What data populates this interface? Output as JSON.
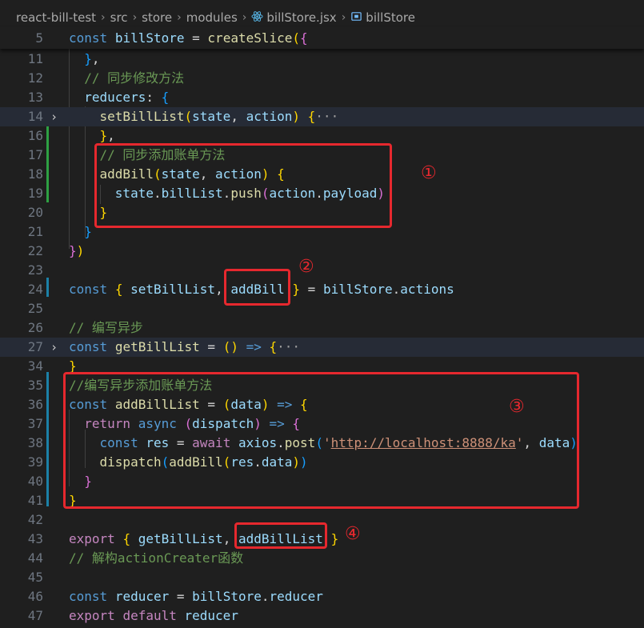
{
  "breadcrumb": {
    "items": [
      "react-bill-test",
      "src",
      "store",
      "modules",
      "billStore.jsx",
      "billStore"
    ],
    "separator": "›"
  },
  "sticky": {
    "line_number": "5",
    "tokens": [
      [
        "const",
        "k"
      ],
      [
        " ",
        "p"
      ],
      [
        "billStore",
        "v"
      ],
      [
        " = ",
        "p"
      ],
      [
        "createSlice",
        "f"
      ],
      [
        "(",
        "b1"
      ],
      [
        "{",
        "b2"
      ]
    ]
  },
  "code_lines": [
    {
      "n": "11",
      "tokens": [
        [
          "  ",
          "p"
        ],
        [
          "}",
          "b3"
        ],
        [
          ",",
          "p"
        ]
      ]
    },
    {
      "n": "12",
      "tokens": [
        [
          "  ",
          "p"
        ],
        [
          "// 同步修改方法",
          "cm"
        ]
      ]
    },
    {
      "n": "13",
      "tokens": [
        [
          "  ",
          "p"
        ],
        [
          "reducers",
          "v"
        ],
        [
          ": ",
          "p"
        ],
        [
          "{",
          "b3"
        ]
      ]
    },
    {
      "n": "14",
      "fold": "›",
      "highlight": true,
      "tokens": [
        [
          "    ",
          "p"
        ],
        [
          "setBillList",
          "f"
        ],
        [
          "(",
          "b1"
        ],
        [
          "state",
          "v"
        ],
        [
          ", ",
          "p"
        ],
        [
          "action",
          "v"
        ],
        [
          ")",
          "b1"
        ],
        [
          " ",
          "p"
        ],
        [
          "{",
          "b1"
        ],
        [
          "···",
          "dots"
        ]
      ]
    },
    {
      "n": "16",
      "tokens": [
        [
          "    ",
          "p"
        ],
        [
          "}",
          "b1"
        ],
        [
          ",",
          "p"
        ]
      ]
    },
    {
      "n": "17",
      "tokens": [
        [
          "    ",
          "p"
        ],
        [
          "// 同步添加账单方法",
          "cm"
        ]
      ]
    },
    {
      "n": "18",
      "tokens": [
        [
          "    ",
          "p"
        ],
        [
          "addBill",
          "f"
        ],
        [
          "(",
          "b1"
        ],
        [
          "state",
          "v"
        ],
        [
          ", ",
          "p"
        ],
        [
          "action",
          "v"
        ],
        [
          ")",
          "b1"
        ],
        [
          " ",
          "p"
        ],
        [
          "{",
          "b1"
        ]
      ]
    },
    {
      "n": "19",
      "tokens": [
        [
          "      ",
          "p"
        ],
        [
          "state",
          "v"
        ],
        [
          ".",
          "p"
        ],
        [
          "billList",
          "v"
        ],
        [
          ".",
          "p"
        ],
        [
          "push",
          "f"
        ],
        [
          "(",
          "b2"
        ],
        [
          "action",
          "v"
        ],
        [
          ".",
          "p"
        ],
        [
          "payload",
          "v"
        ],
        [
          ")",
          "b2"
        ]
      ]
    },
    {
      "n": "20",
      "tokens": [
        [
          "    ",
          "p"
        ],
        [
          "}",
          "b1"
        ]
      ]
    },
    {
      "n": "21",
      "tokens": [
        [
          "  ",
          "p"
        ],
        [
          "}",
          "b3"
        ]
      ]
    },
    {
      "n": "22",
      "tokens": [
        [
          "}",
          "b2"
        ],
        [
          ")",
          "b1"
        ]
      ]
    },
    {
      "n": "23",
      "tokens": []
    },
    {
      "n": "24",
      "tokens": [
        [
          "const",
          "k"
        ],
        [
          " ",
          "p"
        ],
        [
          "{",
          "b1"
        ],
        [
          " ",
          "p"
        ],
        [
          "setBillList",
          "v"
        ],
        [
          ", ",
          "p"
        ],
        [
          "addBill",
          "v"
        ],
        [
          " ",
          "p"
        ],
        [
          "}",
          "b1"
        ],
        [
          " = ",
          "p"
        ],
        [
          "billStore",
          "v"
        ],
        [
          ".",
          "p"
        ],
        [
          "actions",
          "v"
        ]
      ]
    },
    {
      "n": "25",
      "tokens": []
    },
    {
      "n": "26",
      "tokens": [
        [
          "// 编写异步",
          "cm"
        ]
      ]
    },
    {
      "n": "27",
      "fold": "›",
      "highlight": true,
      "tokens": [
        [
          "const",
          "k"
        ],
        [
          " ",
          "p"
        ],
        [
          "getBillList",
          "f"
        ],
        [
          " = ",
          "p"
        ],
        [
          "()",
          "b1"
        ],
        [
          " ",
          "p"
        ],
        [
          "=>",
          "k"
        ],
        [
          " ",
          "p"
        ],
        [
          "{",
          "b1"
        ],
        [
          "···",
          "dots"
        ]
      ]
    },
    {
      "n": "34",
      "tokens": [
        [
          "}",
          "b1"
        ]
      ]
    },
    {
      "n": "35",
      "tokens": [
        [
          "//编写异步添加账单方法",
          "cm"
        ]
      ]
    },
    {
      "n": "36",
      "tokens": [
        [
          "const",
          "k"
        ],
        [
          " ",
          "p"
        ],
        [
          "addBillList",
          "f"
        ],
        [
          " = ",
          "p"
        ],
        [
          "(",
          "b1"
        ],
        [
          "data",
          "v"
        ],
        [
          ")",
          "b1"
        ],
        [
          " ",
          "p"
        ],
        [
          "=>",
          "k"
        ],
        [
          " ",
          "p"
        ],
        [
          "{",
          "b1"
        ]
      ]
    },
    {
      "n": "37",
      "tokens": [
        [
          "  ",
          "p"
        ],
        [
          "return",
          "c"
        ],
        [
          " ",
          "p"
        ],
        [
          "async",
          "k"
        ],
        [
          " ",
          "p"
        ],
        [
          "(",
          "b2"
        ],
        [
          "dispatch",
          "v"
        ],
        [
          ")",
          "b2"
        ],
        [
          " ",
          "p"
        ],
        [
          "=>",
          "k"
        ],
        [
          " ",
          "p"
        ],
        [
          "{",
          "b2"
        ]
      ]
    },
    {
      "n": "38",
      "tokens": [
        [
          "    ",
          "p"
        ],
        [
          "const",
          "k"
        ],
        [
          " ",
          "p"
        ],
        [
          "res",
          "v"
        ],
        [
          " = ",
          "p"
        ],
        [
          "await",
          "c"
        ],
        [
          " ",
          "p"
        ],
        [
          "axios",
          "v"
        ],
        [
          ".",
          "p"
        ],
        [
          "post",
          "f"
        ],
        [
          "(",
          "b3"
        ],
        [
          "'",
          "s"
        ],
        [
          "http://localhost:8888/ka",
          "s url"
        ],
        [
          "'",
          "s"
        ],
        [
          ", ",
          "p"
        ],
        [
          "data",
          "v"
        ],
        [
          ")",
          "b3"
        ]
      ]
    },
    {
      "n": "39",
      "tokens": [
        [
          "    ",
          "p"
        ],
        [
          "dispatch",
          "f"
        ],
        [
          "(",
          "b3"
        ],
        [
          "addBill",
          "f"
        ],
        [
          "(",
          "b1"
        ],
        [
          "res",
          "v"
        ],
        [
          ".",
          "p"
        ],
        [
          "data",
          "v"
        ],
        [
          ")",
          "b1"
        ],
        [
          ")",
          "b3"
        ]
      ]
    },
    {
      "n": "40",
      "tokens": [
        [
          "  ",
          "p"
        ],
        [
          "}",
          "b2"
        ]
      ]
    },
    {
      "n": "41",
      "tokens": [
        [
          "}",
          "b1"
        ]
      ]
    },
    {
      "n": "42",
      "tokens": []
    },
    {
      "n": "43",
      "tokens": [
        [
          "export",
          "c"
        ],
        [
          " ",
          "p"
        ],
        [
          "{",
          "b1"
        ],
        [
          " ",
          "p"
        ],
        [
          "getBillList",
          "v"
        ],
        [
          ", ",
          "p"
        ],
        [
          "addBillList",
          "v"
        ],
        [
          " ",
          "p"
        ],
        [
          "}",
          "b1"
        ]
      ]
    },
    {
      "n": "44",
      "tokens": [
        [
          "// 解构actionCreater函数",
          "cm"
        ]
      ]
    },
    {
      "n": "45",
      "tokens": []
    },
    {
      "n": "46",
      "tokens": [
        [
          "const",
          "k"
        ],
        [
          " ",
          "p"
        ],
        [
          "reducer",
          "v"
        ],
        [
          " = ",
          "p"
        ],
        [
          "billStore",
          "v"
        ],
        [
          ".",
          "p"
        ],
        [
          "reducer",
          "v"
        ]
      ]
    },
    {
      "n": "47",
      "tokens": [
        [
          "export",
          "c"
        ],
        [
          " ",
          "p"
        ],
        [
          "default",
          "c"
        ],
        [
          " ",
          "p"
        ],
        [
          "reducer",
          "v"
        ]
      ]
    }
  ],
  "annotations": [
    "①",
    "②",
    "③",
    "④"
  ],
  "colors": {
    "background": "#1f1f1f",
    "annotation": "#e6282e",
    "added_gutter": "#2ea043",
    "modified_gutter": "#1b81a8"
  }
}
